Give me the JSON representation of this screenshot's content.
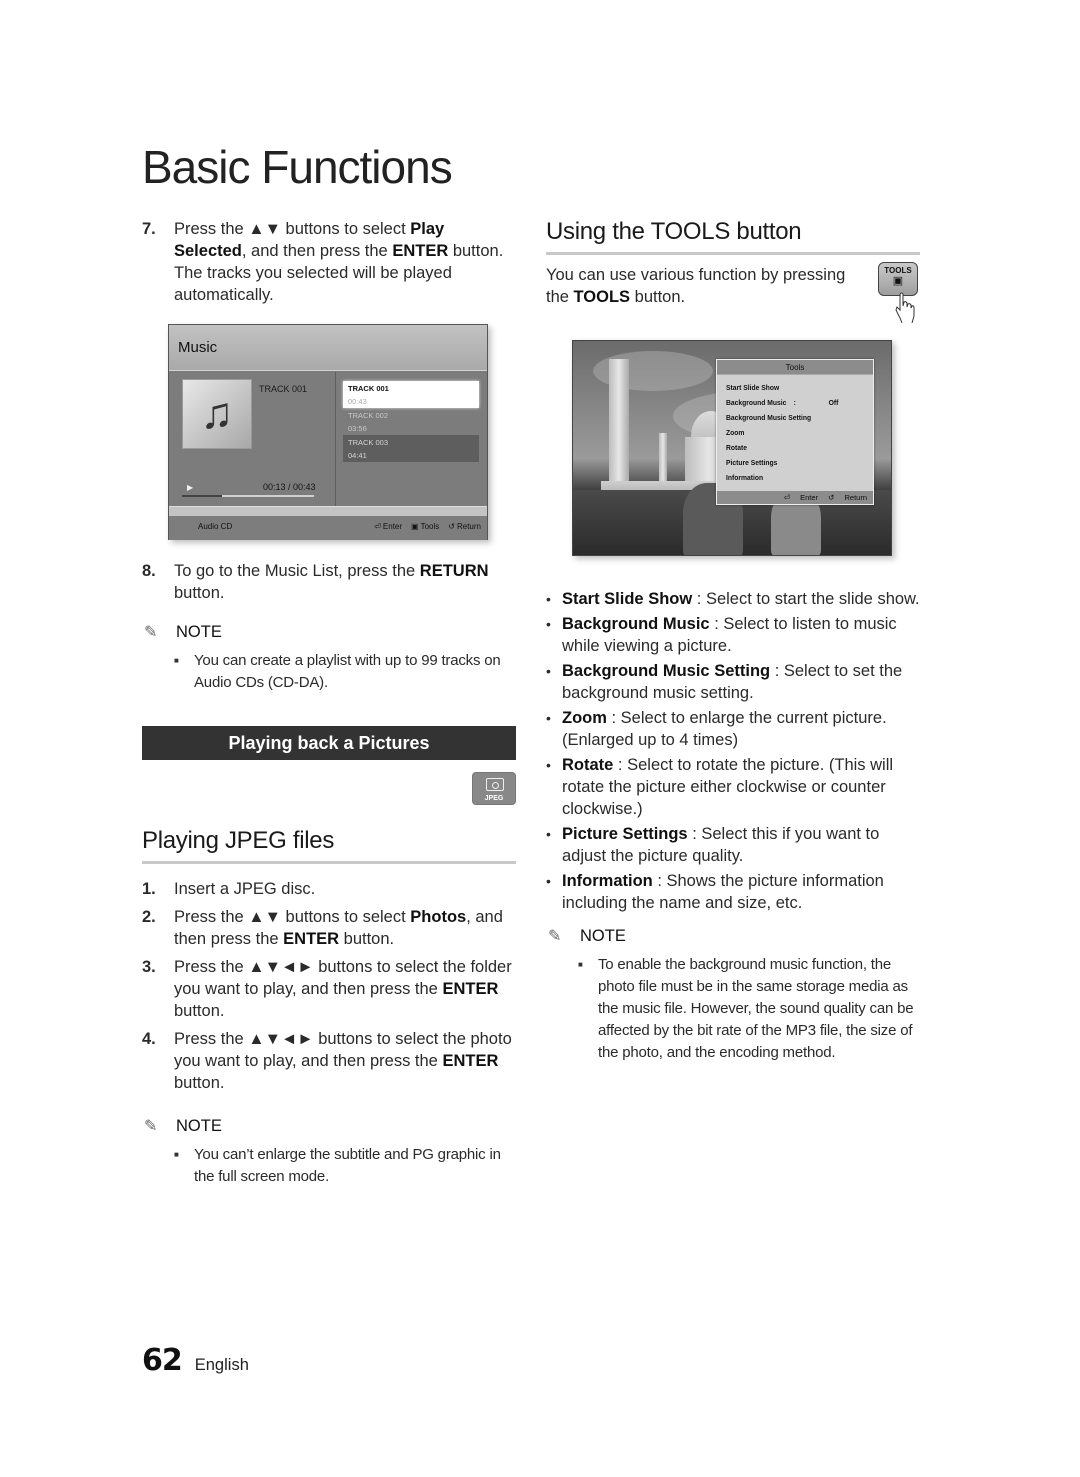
{
  "page_title": "Basic Functions",
  "left": {
    "step7": {
      "num": "7.",
      "pre": "Press the ▲▼ buttons to select ",
      "bold1": "Play Selected",
      "mid": ", and then press the ",
      "bold2": "ENTER",
      "post": " button. The tracks you selected will be played automatically."
    },
    "music_screen": {
      "title": "Music",
      "now_playing": "TRACK 001",
      "elapsed_time": "00:13 / 00:43",
      "progress_fraction": 0.3,
      "tracks": [
        {
          "name": "TRACK 001",
          "duration": "00:43",
          "state": "selected"
        },
        {
          "name": "TRACK 002",
          "duration": "03:56",
          "state": "normal"
        },
        {
          "name": "TRACK 003",
          "duration": "04:41",
          "state": "highlighted"
        }
      ],
      "source": "Audio CD",
      "buttons": {
        "enter": "Enter",
        "tools": "Tools",
        "return": "Return"
      }
    },
    "step8": {
      "num": "8.",
      "pre": "To go to the Music List, press the ",
      "bold": "RETURN",
      "post": " button."
    },
    "note1": {
      "label": "NOTE",
      "items": [
        "You can create a playlist with up to 99 tracks on Audio CDs (CD-DA)."
      ]
    },
    "section_banner": "Playing back a Pictures",
    "jpeg_badge": "JPEG",
    "subsection_title": "Playing JPEG files",
    "steps": [
      {
        "num": "1.",
        "parts": [
          {
            "t": "Insert a JPEG disc.",
            "b": false
          }
        ]
      },
      {
        "num": "2.",
        "parts": [
          {
            "t": "Press the ▲▼ buttons to select ",
            "b": false
          },
          {
            "t": "Photos",
            "b": true
          },
          {
            "t": ", and then press the ",
            "b": false
          },
          {
            "t": "ENTER",
            "b": true
          },
          {
            "t": " button.",
            "b": false
          }
        ]
      },
      {
        "num": "3.",
        "parts": [
          {
            "t": "Press the ▲▼◄► buttons to select the folder you want to play, and then press the ",
            "b": false
          },
          {
            "t": "ENTER",
            "b": true
          },
          {
            "t": " button.",
            "b": false
          }
        ]
      },
      {
        "num": "4.",
        "parts": [
          {
            "t": "Press the ▲▼◄► buttons to select the photo you want to play, and then press the ",
            "b": false
          },
          {
            "t": "ENTER",
            "b": true
          },
          {
            "t": " button.",
            "b": false
          }
        ]
      }
    ],
    "note2": {
      "label": "NOTE",
      "items": [
        "You can’t enlarge the subtitle and PG graphic in the full screen mode."
      ]
    }
  },
  "right": {
    "title": "Using the TOOLS button",
    "intro_pre": "You can use various function by pressing the ",
    "intro_bold": "TOOLS",
    "intro_post": " button.",
    "tools_key_label": "TOOLS",
    "tools_menu": {
      "title": "Tools",
      "items": [
        {
          "label": "Start Slide Show",
          "value": ""
        },
        {
          "label": "Background Music",
          "value": "Off"
        },
        {
          "label": "Background Music Setting",
          "value": ""
        },
        {
          "label": "Zoom",
          "value": ""
        },
        {
          "label": "Rotate",
          "value": ""
        },
        {
          "label": "Picture Settings",
          "value": ""
        },
        {
          "label": "Information",
          "value": ""
        }
      ],
      "separator": ":",
      "footer": {
        "enter": "Enter",
        "return": "Return"
      }
    },
    "bullets": [
      {
        "term": "Start Slide Show",
        "desc": " : Select to start the slide show."
      },
      {
        "term": "Background Music",
        "desc": " : Select to listen to music while viewing a picture."
      },
      {
        "term": "Background Music Setting",
        "desc": " : Select to set the background music setting."
      },
      {
        "term": "Zoom",
        "desc": " : Select to enlarge the current picture. (Enlarged up to 4 times)"
      },
      {
        "term": "Rotate",
        "desc": " : Select to rotate the picture. (This will rotate the picture either clockwise or counter clockwise.)"
      },
      {
        "term": "Picture Settings",
        "desc": " : Select this if you want to adjust the picture quality."
      },
      {
        "term": "Information",
        "desc": " : Shows the picture information including the name and size, etc."
      }
    ],
    "note": {
      "label": "NOTE",
      "items": [
        "To enable the background music function, the photo file must be in the same storage media as the music file. However, the sound quality can be affected by the bit rate of the MP3 file, the size of the photo, and the encoding method."
      ]
    }
  },
  "footer": {
    "page_number": "62",
    "language": "English"
  }
}
